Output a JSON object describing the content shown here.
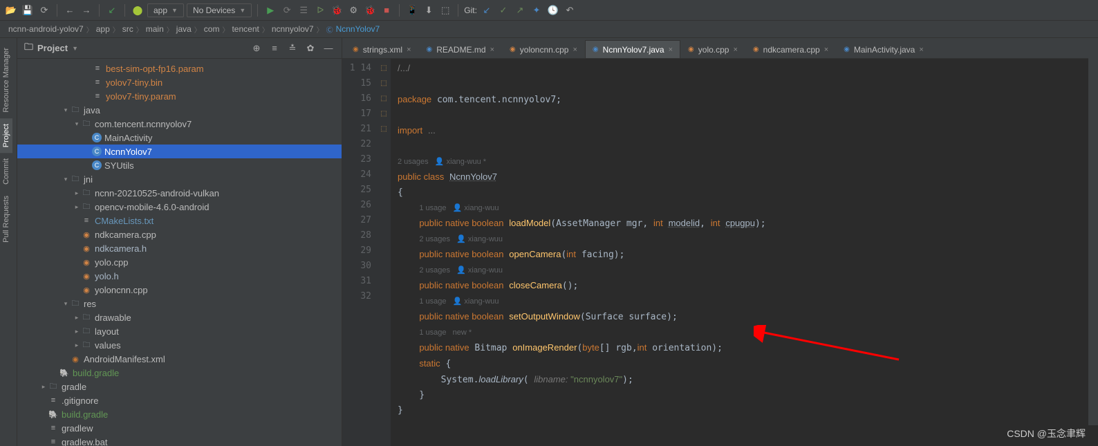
{
  "toolbar": {
    "combo_app": "app",
    "combo_devices": "No Devices",
    "git_label": "Git:"
  },
  "breadcrumbs": [
    "ncnn-android-yolov7",
    "app",
    "src",
    "main",
    "java",
    "com",
    "tencent",
    "ncnnyolov7",
    "NcnnYolov7"
  ],
  "panel_title": "Project",
  "tree": [
    {
      "d": 6,
      "c": "",
      "i": "txt",
      "l": "best-sim-opt-fp16.param",
      "color": "#d28445"
    },
    {
      "d": 6,
      "c": "",
      "i": "txt",
      "l": "yolov7-tiny.bin",
      "color": "#d28445"
    },
    {
      "d": 6,
      "c": "",
      "i": "txt",
      "l": "yolov7-tiny.param",
      "color": "#d28445"
    },
    {
      "d": 4,
      "c": "▾",
      "i": "folder",
      "l": "java"
    },
    {
      "d": 5,
      "c": "▾",
      "i": "folder",
      "l": "com.tencent.ncnnyolov7"
    },
    {
      "d": 6,
      "c": "",
      "i": "class",
      "l": "MainActivity"
    },
    {
      "d": 6,
      "c": "",
      "i": "class",
      "l": "NcnnYolov7",
      "sel": true
    },
    {
      "d": 6,
      "c": "",
      "i": "class",
      "l": "SYUtils"
    },
    {
      "d": 4,
      "c": "▾",
      "i": "folder",
      "l": "jni"
    },
    {
      "d": 5,
      "c": "▸",
      "i": "folder",
      "l": "ncnn-20210525-android-vulkan"
    },
    {
      "d": 5,
      "c": "▸",
      "i": "folder",
      "l": "opencv-mobile-4.6.0-android"
    },
    {
      "d": 5,
      "c": "",
      "i": "txt",
      "l": "CMakeLists.txt",
      "color": "#6897bb"
    },
    {
      "d": 5,
      "c": "",
      "i": "cpp",
      "l": "ndkcamera.cpp"
    },
    {
      "d": 5,
      "c": "",
      "i": "cpp",
      "l": "ndkcamera.h",
      "color": "#a9b7c6"
    },
    {
      "d": 5,
      "c": "",
      "i": "cpp",
      "l": "yolo.cpp"
    },
    {
      "d": 5,
      "c": "",
      "i": "cpp",
      "l": "yolo.h",
      "color": "#a9b7c6"
    },
    {
      "d": 5,
      "c": "",
      "i": "cpp",
      "l": "yoloncnn.cpp"
    },
    {
      "d": 4,
      "c": "▾",
      "i": "folder",
      "l": "res"
    },
    {
      "d": 5,
      "c": "▸",
      "i": "folder",
      "l": "drawable"
    },
    {
      "d": 5,
      "c": "▸",
      "i": "folder",
      "l": "layout"
    },
    {
      "d": 5,
      "c": "▸",
      "i": "folder",
      "l": "values"
    },
    {
      "d": 4,
      "c": "",
      "i": "xml",
      "l": "AndroidManifest.xml"
    },
    {
      "d": 3,
      "c": "",
      "i": "gradle",
      "l": "build.gradle",
      "color": "#629755"
    },
    {
      "d": 2,
      "c": "▸",
      "i": "folder",
      "l": "gradle"
    },
    {
      "d": 2,
      "c": "",
      "i": "txt",
      "l": ".gitignore"
    },
    {
      "d": 2,
      "c": "",
      "i": "gradle",
      "l": "build.gradle",
      "color": "#629755"
    },
    {
      "d": 2,
      "c": "",
      "i": "txt",
      "l": "gradlew"
    },
    {
      "d": 2,
      "c": "",
      "i": "txt",
      "l": "gradlew.bat"
    }
  ],
  "tabs": [
    {
      "ico": "xml",
      "label": "strings.xml"
    },
    {
      "ico": "md",
      "label": "README.md"
    },
    {
      "ico": "cpp",
      "label": "yoloncnn.cpp"
    },
    {
      "ico": "java",
      "label": "NcnnYolov7.java",
      "active": true
    },
    {
      "ico": "cpp",
      "label": "yolo.cpp"
    },
    {
      "ico": "cpp",
      "label": "ndkcamera.cpp"
    },
    {
      "ico": "java",
      "label": "MainActivity.java"
    }
  ],
  "lines": [
    "1",
    "14",
    "15",
    "16",
    "17",
    "",
    "21",
    "22",
    "",
    "23",
    "",
    "24",
    "",
    "25",
    "",
    "26",
    "",
    "27",
    "28",
    "29",
    "30",
    "31",
    "32"
  ],
  "code": {
    "fold": "/.../",
    "pkg": "package com.tencent.ncnnyolov7;",
    "imp": "import ...",
    "u1": "2 usages   ",
    "auth": "xiang-wuu *",
    "cls": "public class NcnnYolov7",
    "ob": "{",
    "u2": "1 usage   ",
    "a2": "xiang-wuu",
    "m1a": "public native boolean ",
    "m1b": "loadModel",
    "m1c": "(AssetManager mgr, int ",
    "m1d": "modelid",
    "m1e": ", int ",
    "m1f": "cpugpu",
    "m1g": ");",
    "u3": "2 usages   ",
    "m2a": "public native boolean ",
    "m2b": "openCamera",
    "m2c": "(int facing);",
    "u4": "2 usages   ",
    "m3a": "public native boolean ",
    "m3b": "closeCamera",
    "m3c": "();",
    "u5": "1 usage   ",
    "m4a": "public native boolean ",
    "m4b": "setOutputWindow",
    "m4c": "(Surface surface);",
    "u6": "1 usage   new *",
    "m5a": "public native Bitmap ",
    "m5b": "onImageRender",
    "m5c": "(byte[] rgb,int orientation);",
    "st": "static {",
    "ll1": "System.",
    "ll2": "loadLibrary",
    "ll3": "( ",
    "llp": "libname: ",
    "lls": "\"ncnnyolov7\"",
    "ll4": ");",
    "cb": "}",
    "cb2": "}"
  },
  "side_tabs": [
    "Resource Manager",
    "Project",
    "Commit",
    "Pull Requests"
  ],
  "footer": "CSDN @玉念聿辉"
}
